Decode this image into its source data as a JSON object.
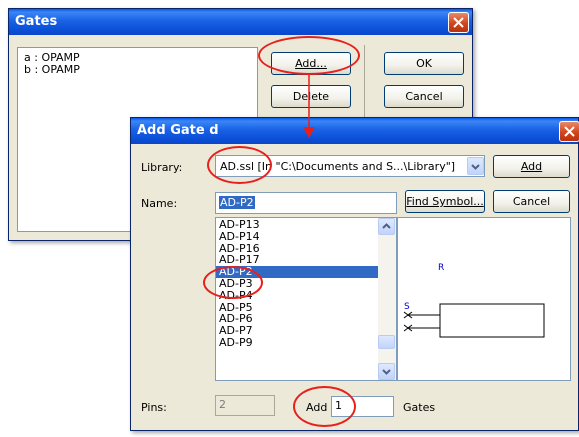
{
  "gates_window": {
    "title": "Gates",
    "gate_list": [
      "a : OPAMP",
      "b : OPAMP"
    ],
    "add_button": "Add...",
    "delete_button": "Delete",
    "ok_button": "OK",
    "cancel_button": "Cancel"
  },
  "add_gate_window": {
    "title": "Add Gate d",
    "library_label": "Library:",
    "library_value": "AD.ssl   [In \"C:\\Documents and S...\\Library\"]",
    "add_button": "Add",
    "name_label": "Name:",
    "name_value": "AD-P2",
    "find_symbol_button": "Find Symbol...",
    "cancel_button": "Cancel",
    "symbol_list": [
      "AD-P13",
      "AD-P14",
      "AD-P16",
      "AD-P17",
      "AD-P2",
      "AD-P3",
      "AD-P4",
      "AD-P5",
      "AD-P6",
      "AD-P7",
      "AD-P9"
    ],
    "selected_symbol": "AD-P2",
    "preview": {
      "ref_label": "R",
      "pin_label": "S"
    },
    "pins_label": "Pins:",
    "pins_value": "2",
    "add_count_label": "Add",
    "add_count_value": "1",
    "gates_label": "Gates"
  },
  "colors": {
    "annotation": "#e8201c",
    "selection": "#316ac5",
    "preview_text": "#0000cc"
  }
}
